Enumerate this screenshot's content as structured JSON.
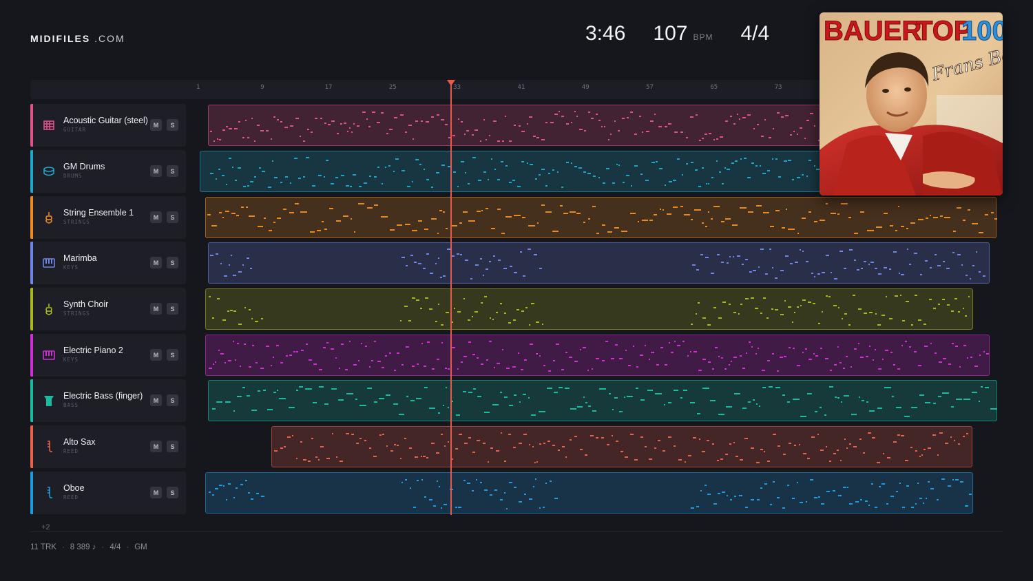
{
  "brand": {
    "bold": "MIDIFILES",
    "light": ".COM"
  },
  "stats": {
    "time": "3:46",
    "bpm": "107",
    "bpm_unit": "BPM",
    "signature": "4/4"
  },
  "album": {
    "title_a": "BAUER",
    "title_b": "TOP",
    "title_c": "100",
    "signature_text": "Frans Bauer"
  },
  "ruler": {
    "ticks": [
      "1",
      "9",
      "17",
      "25",
      "33",
      "41",
      "49",
      "57",
      "65",
      "73"
    ]
  },
  "playhead_bar": 33,
  "tracks": [
    {
      "name": "Acoustic Guitar (steel)",
      "category": "GUITAR",
      "color": "#e0528a",
      "icon": "guitar-icon",
      "mute": "M",
      "solo": "S"
    },
    {
      "name": "GM Drums",
      "category": "DRUMS",
      "color": "#1fa7c9",
      "icon": "drum-icon",
      "mute": "M",
      "solo": "S"
    },
    {
      "name": "String Ensemble 1",
      "category": "STRINGS",
      "color": "#ec8a22",
      "icon": "strings-icon",
      "mute": "M",
      "solo": "S"
    },
    {
      "name": "Marimba",
      "category": "KEYS",
      "color": "#6f86e6",
      "icon": "keys-icon",
      "mute": "M",
      "solo": "S"
    },
    {
      "name": "Synth Choir",
      "category": "STRINGS",
      "color": "#a8b81e",
      "icon": "strings-icon",
      "mute": "M",
      "solo": "S"
    },
    {
      "name": "Electric Piano 2",
      "category": "KEYS",
      "color": "#d12fd6",
      "icon": "keys-icon",
      "mute": "M",
      "solo": "S"
    },
    {
      "name": "Electric Bass (finger)",
      "category": "BASS",
      "color": "#19bca2",
      "icon": "bass-icon",
      "mute": "M",
      "solo": "S"
    },
    {
      "name": "Alto Sax",
      "category": "REED",
      "color": "#e8614a",
      "icon": "reed-icon",
      "mute": "M",
      "solo": "S"
    },
    {
      "name": "Oboe",
      "category": "REED",
      "color": "#1f9be0",
      "icon": "reed-icon",
      "mute": "M",
      "solo": "S"
    }
  ],
  "more_tracks": "+2",
  "footer": {
    "tracks": "11 TRK",
    "notes": "8 389 ♪",
    "signature": "4/4",
    "standard": "GM"
  }
}
